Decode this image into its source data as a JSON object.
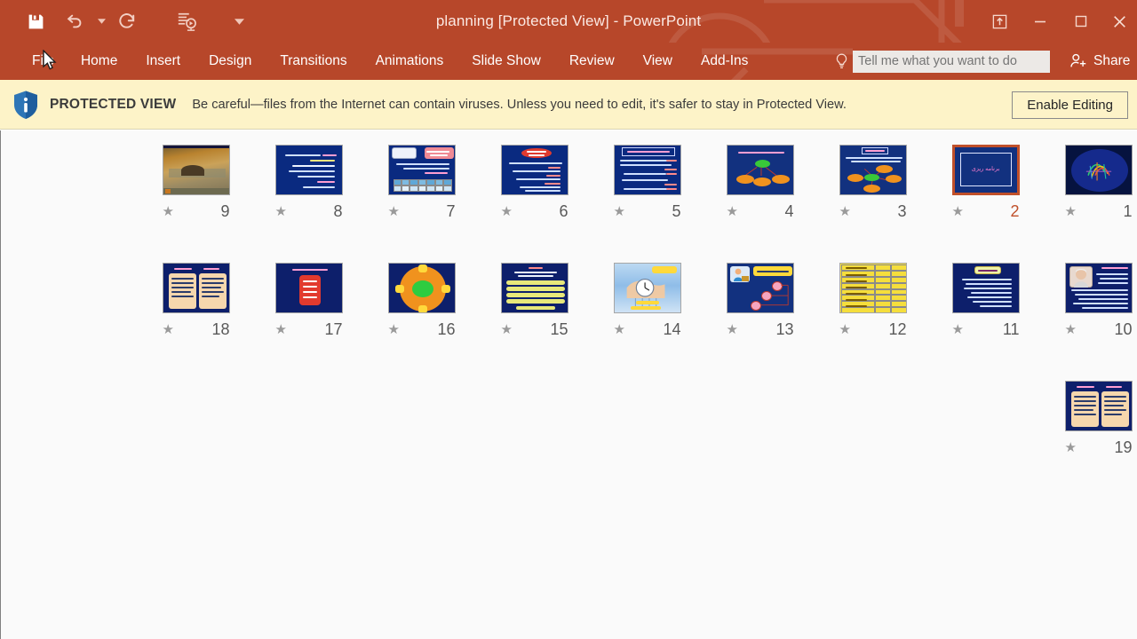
{
  "window": {
    "title": "planning [Protected View] - PowerPoint",
    "accent_color": "#b7472a",
    "controls": {
      "ribbon_display_options": "ribbon-display-options",
      "minimize": "minimize",
      "restore": "restore",
      "close": "close"
    }
  },
  "quick_access": {
    "items": [
      {
        "name": "save-icon",
        "label": "Save"
      },
      {
        "name": "undo-icon",
        "label": "Undo"
      },
      {
        "name": "undo-dropdown-caret",
        "label": "Undo options"
      },
      {
        "name": "redo-icon",
        "label": "Redo"
      },
      {
        "name": "start-presentation-icon",
        "label": "Start From Beginning"
      },
      {
        "name": "customize-quick-access-toolbar-caret",
        "label": "Customize Quick Access Toolbar"
      }
    ]
  },
  "ribbon": {
    "tabs": [
      {
        "label": "File",
        "active": false
      },
      {
        "label": "Home",
        "active": false
      },
      {
        "label": "Insert",
        "active": false
      },
      {
        "label": "Design",
        "active": false
      },
      {
        "label": "Transitions",
        "active": false
      },
      {
        "label": "Animations",
        "active": false
      },
      {
        "label": "Slide Show",
        "active": false
      },
      {
        "label": "Review",
        "active": false
      },
      {
        "label": "View",
        "active": false
      },
      {
        "label": "Add-Ins",
        "active": false
      }
    ],
    "tell_me_placeholder": "Tell me what you want to do",
    "tell_me_value": "",
    "share_label": "Share"
  },
  "protected_view": {
    "badge": "PROTECTED VIEW",
    "message": "Be careful—files from the Internet can contain viruses. Unless you need to edit, it's safer to stay in Protected View.",
    "button_label": "Enable Editing",
    "bar_color": "#fdf3c8",
    "icon": "shield-info-icon"
  },
  "slide_sorter": {
    "selected_slide": 2,
    "rows": [
      {
        "slides": [
          {
            "number": "9",
            "style": "autumn",
            "selected": false
          },
          {
            "number": "8",
            "style": "navy-text",
            "selected": false
          },
          {
            "number": "7",
            "style": "pink-table",
            "selected": false
          },
          {
            "number": "6",
            "style": "red-oval",
            "selected": false
          },
          {
            "number": "5",
            "style": "title-list",
            "selected": false
          },
          {
            "number": "4",
            "style": "diagram3",
            "selected": false
          },
          {
            "number": "3",
            "style": "diagram5",
            "selected": false
          },
          {
            "number": "2",
            "style": "title-slide",
            "selected": true,
            "title_text": "برنامه ریزی"
          },
          {
            "number": "1",
            "style": "calligraphy",
            "selected": false
          }
        ]
      },
      {
        "slides": [
          {
            "number": "18",
            "style": "two-panels",
            "selected": false
          },
          {
            "number": "17",
            "style": "red-rounded",
            "selected": false
          },
          {
            "number": "16",
            "style": "donut",
            "selected": false
          },
          {
            "number": "15",
            "style": "yellow-rows",
            "selected": false
          },
          {
            "number": "14",
            "style": "clock-hand",
            "selected": false
          },
          {
            "number": "13",
            "style": "cartoon",
            "selected": false
          },
          {
            "number": "12",
            "style": "yellow-table",
            "selected": false
          },
          {
            "number": "11",
            "style": "yellow-title",
            "selected": false
          },
          {
            "number": "10",
            "style": "photo-text",
            "selected": false
          }
        ]
      },
      {
        "slides": [
          {
            "number": "19",
            "style": "two-panels",
            "selected": false
          }
        ]
      }
    ],
    "star_icon": "star-icon"
  }
}
